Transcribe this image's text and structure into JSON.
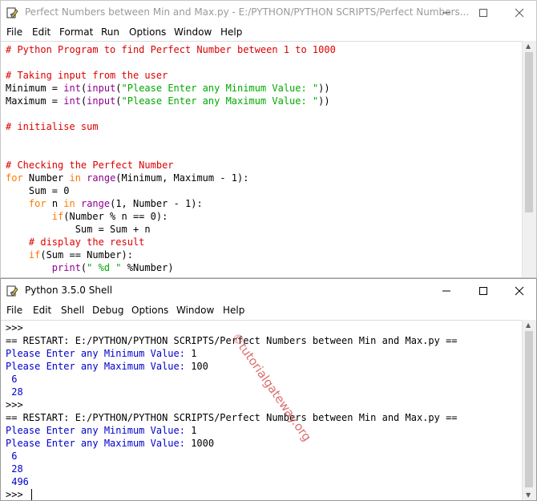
{
  "editor": {
    "title": "Perfect Numbers between Min and Max.py - E:/PYTHON/PYTHON SCRIPTS/Perfect Numbers...",
    "menu": [
      "File",
      "Edit",
      "Format",
      "Run",
      "Options",
      "Window",
      "Help"
    ],
    "code": [
      [
        {
          "c": "cm",
          "t": "# Python Program to find Perfect Number between 1 to 1000"
        }
      ],
      [],
      [
        {
          "c": "cm",
          "t": "# Taking input from the user"
        }
      ],
      [
        {
          "c": "df",
          "t": "Minimum = "
        },
        {
          "c": "bi",
          "t": "int"
        },
        {
          "c": "df",
          "t": "("
        },
        {
          "c": "bi",
          "t": "input"
        },
        {
          "c": "df",
          "t": "("
        },
        {
          "c": "st",
          "t": "\"Please Enter any Minimum Value: \""
        },
        {
          "c": "df",
          "t": "))"
        }
      ],
      [
        {
          "c": "df",
          "t": "Maximum = "
        },
        {
          "c": "bi",
          "t": "int"
        },
        {
          "c": "df",
          "t": "("
        },
        {
          "c": "bi",
          "t": "input"
        },
        {
          "c": "df",
          "t": "("
        },
        {
          "c": "st",
          "t": "\"Please Enter any Maximum Value: \""
        },
        {
          "c": "df",
          "t": "))"
        }
      ],
      [],
      [
        {
          "c": "cm",
          "t": "# initialise sum"
        }
      ],
      [],
      [],
      [
        {
          "c": "cm",
          "t": "# Checking the Perfect Number"
        }
      ],
      [
        {
          "c": "kw",
          "t": "for"
        },
        {
          "c": "df",
          "t": " Number "
        },
        {
          "c": "kw",
          "t": "in"
        },
        {
          "c": "df",
          "t": " "
        },
        {
          "c": "bi",
          "t": "range"
        },
        {
          "c": "df",
          "t": "(Minimum, Maximum - 1):"
        }
      ],
      [
        {
          "c": "df",
          "t": "    Sum = 0"
        }
      ],
      [
        {
          "c": "df",
          "t": "    "
        },
        {
          "c": "kw",
          "t": "for"
        },
        {
          "c": "df",
          "t": " n "
        },
        {
          "c": "kw",
          "t": "in"
        },
        {
          "c": "df",
          "t": " "
        },
        {
          "c": "bi",
          "t": "range"
        },
        {
          "c": "df",
          "t": "(1, Number - 1):"
        }
      ],
      [
        {
          "c": "df",
          "t": "        "
        },
        {
          "c": "kw",
          "t": "if"
        },
        {
          "c": "df",
          "t": "(Number % n == 0):"
        }
      ],
      [
        {
          "c": "df",
          "t": "            Sum = Sum + n"
        }
      ],
      [
        {
          "c": "df",
          "t": "    "
        },
        {
          "c": "cm",
          "t": "# display the result"
        }
      ],
      [
        {
          "c": "df",
          "t": "    "
        },
        {
          "c": "kw",
          "t": "if"
        },
        {
          "c": "df",
          "t": "(Sum == Number):"
        }
      ],
      [
        {
          "c": "df",
          "t": "        "
        },
        {
          "c": "bi",
          "t": "print"
        },
        {
          "c": "df",
          "t": "("
        },
        {
          "c": "st",
          "t": "\" %d \""
        },
        {
          "c": "df",
          "t": " %Number)"
        }
      ]
    ]
  },
  "shell": {
    "title": "Python 3.5.0 Shell",
    "menu": [
      "File",
      "Edit",
      "Shell",
      "Debug",
      "Options",
      "Window",
      "Help"
    ],
    "lines": [
      [
        {
          "c": "pr",
          "t": ">>> "
        }
      ],
      [
        {
          "c": "pr",
          "t": "== RESTART: E:/PYTHON/PYTHON SCRIPTS/Perfect Numbers between Min and Max.py =="
        }
      ],
      [
        {
          "c": "in",
          "t": "Please Enter any Minimum Value: "
        },
        {
          "c": "pr",
          "t": "1"
        }
      ],
      [
        {
          "c": "in",
          "t": "Please Enter any Maximum Value: "
        },
        {
          "c": "pr",
          "t": "100"
        }
      ],
      [
        {
          "c": "ou",
          "t": " 6 "
        }
      ],
      [
        {
          "c": "ou",
          "t": " 28 "
        }
      ],
      [
        {
          "c": "pr",
          "t": ">>> "
        }
      ],
      [
        {
          "c": "pr",
          "t": "== RESTART: E:/PYTHON/PYTHON SCRIPTS/Perfect Numbers between Min and Max.py =="
        }
      ],
      [
        {
          "c": "in",
          "t": "Please Enter any Minimum Value: "
        },
        {
          "c": "pr",
          "t": "1"
        }
      ],
      [
        {
          "c": "in",
          "t": "Please Enter any Maximum Value: "
        },
        {
          "c": "pr",
          "t": "1000"
        }
      ],
      [
        {
          "c": "ou",
          "t": " 6 "
        }
      ],
      [
        {
          "c": "ou",
          "t": " 28 "
        }
      ],
      [
        {
          "c": "ou",
          "t": " 496 "
        }
      ],
      [
        {
          "c": "pr",
          "t": ">>> "
        }
      ]
    ]
  },
  "watermark": "©tutorialgateway.org",
  "icons": [
    "idle-python-icon",
    "minimize-icon",
    "maximize-icon",
    "close-icon",
    "scroll-up-arrow-icon",
    "scroll-down-arrow-icon"
  ],
  "colors": {
    "comment": "#dd0000",
    "keyword": "#ff7700",
    "builtin": "#900090",
    "string": "#00aa00",
    "shell_input": "#0000cc",
    "watermark": "#d24a4a"
  }
}
